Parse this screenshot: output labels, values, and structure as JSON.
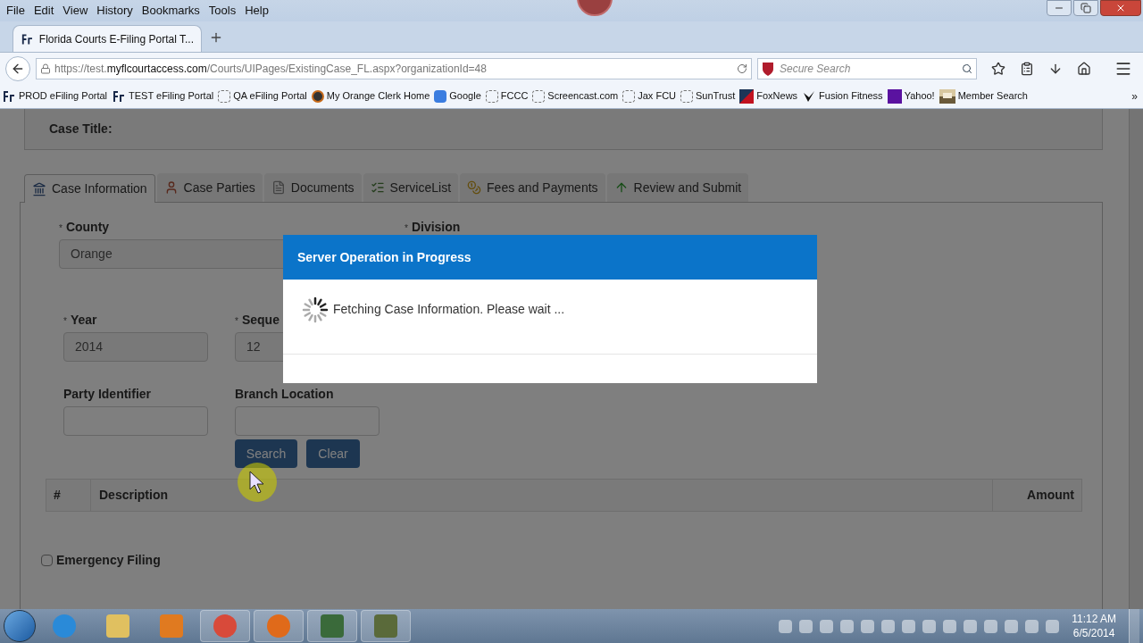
{
  "menu": [
    "File",
    "Edit",
    "View",
    "History",
    "Bookmarks",
    "Tools",
    "Help"
  ],
  "browser_tab": {
    "title": "Florida Courts E-Filing Portal T..."
  },
  "address": {
    "prefix": "https://test.",
    "domain": "myflcourtaccess.com",
    "path": "/Courts/UIPages/ExistingCase_FL.aspx?organizationId=48"
  },
  "search": {
    "placeholder": "Secure Search"
  },
  "bookmarks": [
    {
      "label": "PROD eFiling Portal",
      "kind": "logo"
    },
    {
      "label": "TEST eFiling Portal",
      "kind": "logo"
    },
    {
      "label": "QA eFiling Portal",
      "kind": "blank"
    },
    {
      "label": "My Orange Clerk Home",
      "kind": "seal"
    },
    {
      "label": "Google",
      "kind": "google"
    },
    {
      "label": "FCCC",
      "kind": "blank"
    },
    {
      "label": "Screencast.com",
      "kind": "blank"
    },
    {
      "label": "Jax FCU",
      "kind": "blank"
    },
    {
      "label": "SunTrust",
      "kind": "blank"
    },
    {
      "label": "FoxNews",
      "kind": "news"
    },
    {
      "label": "Fusion Fitness",
      "kind": "check"
    },
    {
      "label": "Yahoo!",
      "kind": "yahoo"
    },
    {
      "label": "Member Search"
    }
  ],
  "overflow": "»",
  "case_title_label": "Case Title:",
  "tabs": [
    {
      "label": "Case Information",
      "selected": true,
      "kind": "case"
    },
    {
      "label": "Case Parties",
      "selected": false,
      "kind": "person"
    },
    {
      "label": "Documents",
      "selected": false,
      "kind": "document"
    },
    {
      "label": "ServiceList",
      "selected": false,
      "kind": "list"
    },
    {
      "label": "Fees and Payments",
      "selected": false,
      "kind": "coins"
    },
    {
      "label": "Review and Submit",
      "selected": false,
      "kind": "arrow"
    }
  ],
  "county": {
    "mark": "*",
    "label": "County",
    "value": "Orange"
  },
  "division": {
    "mark": "*",
    "label": "Division"
  },
  "year": {
    "mark": "*",
    "label": "Year",
    "value": "2014"
  },
  "sequence": {
    "mark": "*",
    "label": "Seque",
    "value": "12"
  },
  "party_identifier": {
    "label": "Party Identifier"
  },
  "branch_location": {
    "label": "Branch Location"
  },
  "buttons": {
    "search": "Search",
    "clear": "Clear"
  },
  "table": {
    "columns": [
      "#",
      "Description",
      "Amount"
    ]
  },
  "emergency_filing": {
    "label": "Emergency Filing",
    "checked": false
  },
  "modal": {
    "title": "Server Operation in Progress",
    "message": "Fetching Case Information. Please wait ..."
  },
  "clock": {
    "time": "11:12 AM",
    "date": "6/5/2014"
  }
}
